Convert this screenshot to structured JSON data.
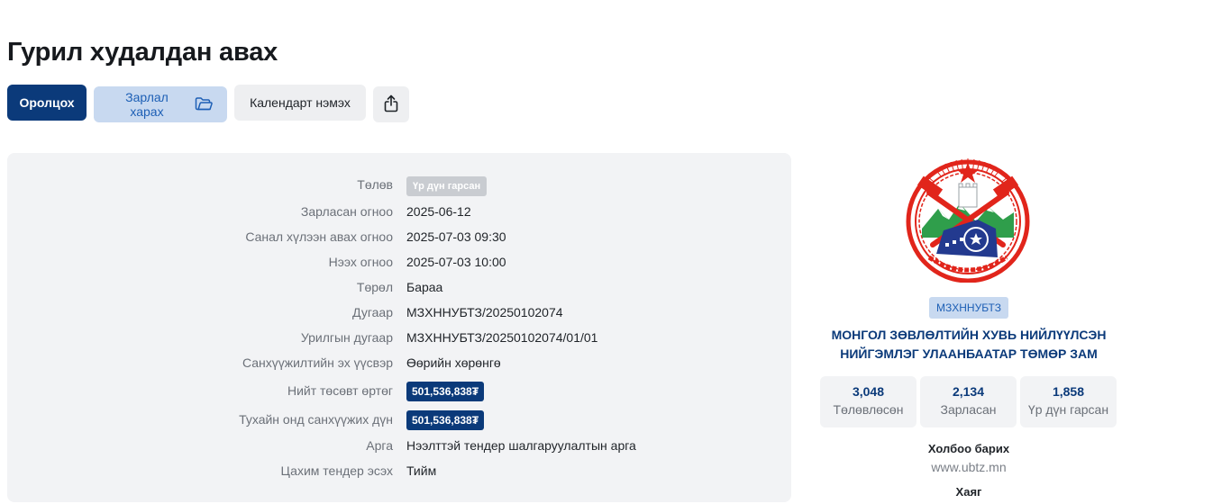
{
  "page": {
    "title": "Гурил худалдан авах"
  },
  "actions": {
    "participate_label": "Оролцох",
    "view_announcement_label": "Зарлал харах",
    "add_calendar_label": "Календарт нэмэх",
    "share_icon": "share-icon",
    "folder_icon": "folder-icon"
  },
  "details": {
    "status": {
      "label": "Төлөв",
      "value": "Үр дүн гарсан"
    },
    "announced_date": {
      "label": "Зарласан огноо",
      "value": "2025-06-12"
    },
    "bid_deadline": {
      "label": "Санал хүлээн авах огноо",
      "value": "2025-07-03 09:30"
    },
    "open_date": {
      "label": "Нээх огноо",
      "value": "2025-07-03 10:00"
    },
    "type": {
      "label": "Төрөл",
      "value": "Бараа"
    },
    "number": {
      "label": "Дугаар",
      "value": "МЗХННУБТЗ/20250102074"
    },
    "invitation_number": {
      "label": "Урилгын дугаар",
      "value": "МЗХННУБТЗ/20250102074/01/01"
    },
    "funding_source": {
      "label": "Санхүүжилтийн эх үүсвэр",
      "value": "Өөрийн хөрөнгө"
    },
    "total_budget": {
      "label": "Нийт төсөвт өртөг",
      "value": "501,536,838₮"
    },
    "year_funding": {
      "label": "Тухайн онд санхүүжих дүн",
      "value": "501,536,838₮"
    },
    "method": {
      "label": "Арга",
      "value": "Нээлттэй тендер шалгаруулалтын арга"
    },
    "e_tender": {
      "label": "Цахим тендер эсэх",
      "value": "Тийм"
    }
  },
  "org": {
    "logo_icon": "ubtz-emblem-icon",
    "abbr": "МЗХННУБТЗ",
    "name_line1": "МОНГОЛ ЗӨВЛӨЛТИЙН ХУВЬ НИЙЛҮҮЛСЭН",
    "name_line2": "НИЙГЭМЛЭГ УЛААНБААТАР ТӨМӨР ЗАМ",
    "stats": [
      {
        "value": "3,048",
        "label": "Төлөвлөсөн"
      },
      {
        "value": "2,134",
        "label": "Зарласан"
      },
      {
        "value": "1,858",
        "label": "Үр дүн гарсан"
      }
    ],
    "contact_heading": "Холбоо барих",
    "website": "www.ubtz.mn",
    "address_heading": "Хаяг"
  },
  "colors": {
    "primary": "#0b3a7a",
    "accent_light": "#c8d9f0",
    "accent_text": "#1d5fb5",
    "card_bg": "#f2f3f5",
    "status_badge": "#c9ccd1",
    "logo_red": "#e1251b"
  }
}
